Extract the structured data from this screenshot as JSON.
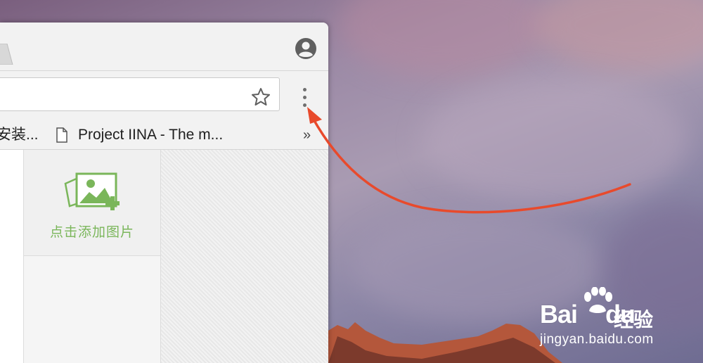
{
  "bookmarks": {
    "items": [
      {
        "label": "安装..."
      },
      {
        "label": "Project IINA - The m..."
      }
    ],
    "overflow": "»"
  },
  "content": {
    "upload_label": "点击添加图片"
  },
  "watermark": {
    "logo_prefix": "Bai",
    "logo_suffix": "du",
    "cn_text": "经验",
    "url": "jingyan.baidu.com"
  },
  "icons": {
    "profile": "account-circle-icon",
    "star": "bookmark-star-icon",
    "menu": "three-dot-menu-icon",
    "page": "page-icon",
    "upload": "add-image-icon"
  },
  "colors": {
    "annotation_arrow": "#e84a2c",
    "upload_green": "#7ab65a"
  }
}
